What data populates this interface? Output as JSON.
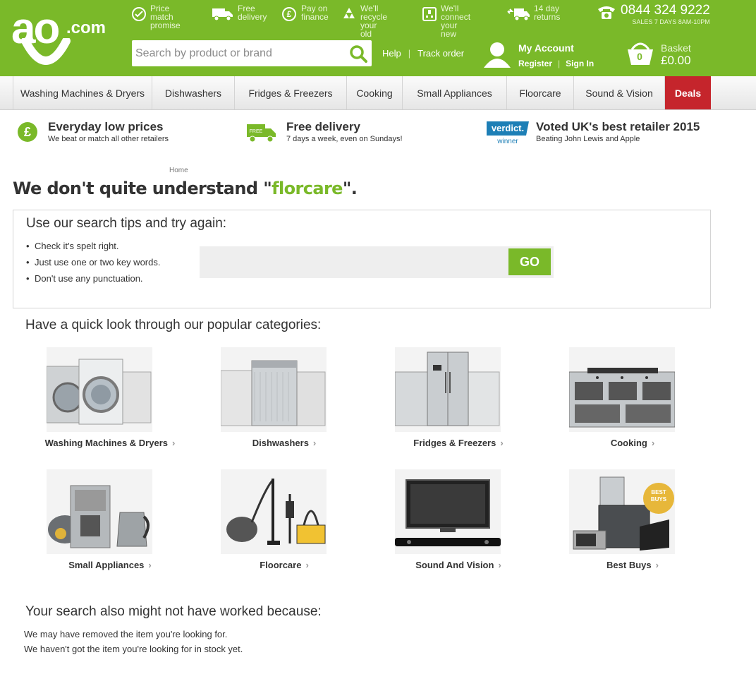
{
  "header": {
    "logo_text": "ao",
    "logo_suffix": ".com",
    "usps": [
      {
        "icon": "price-tag-icon",
        "line1": "Price match",
        "line2": "promise"
      },
      {
        "icon": "delivery-van-icon",
        "line1": "Free",
        "line2": "delivery"
      },
      {
        "icon": "pound-coin-icon",
        "line1": "Pay on",
        "line2": "finance"
      },
      {
        "icon": "recycle-icon",
        "line1": "We'll recycle",
        "line2": "your old"
      },
      {
        "icon": "plug-icon",
        "line1": "We'll connect",
        "line2": "your new"
      },
      {
        "icon": "return-van-icon",
        "line1": "14 day",
        "line2": "returns"
      }
    ],
    "phone_number": "0844 324 9222",
    "phone_hours": "SALES 7 DAYS 8AM-10PM",
    "search_placeholder": "Search by product or brand",
    "help_label": "Help",
    "track_label": "Track order",
    "account_title": "My Account",
    "register_label": "Register",
    "signin_label": "Sign In",
    "basket_count": "0",
    "basket_label": "Basket",
    "basket_total": "£0.00"
  },
  "nav": {
    "items": [
      "Washing Machines & Dryers",
      "Dishwashers",
      "Fridges & Freezers",
      "Cooking",
      "Small Appliances",
      "Floorcare",
      "Sound & Vision"
    ],
    "deals_label": "Deals"
  },
  "promo": [
    {
      "icon": "pound-circle-icon",
      "title": "Everyday low prices",
      "subtitle": "We beat or match all other retailers"
    },
    {
      "icon": "free-delivery-van-icon",
      "title": "Free delivery",
      "subtitle": "7 days a week, even on Sundays!"
    },
    {
      "icon": "verdict-winner-badge",
      "badge_top": "verdict.",
      "badge_bottom": "winner",
      "title": "Voted UK's best retailer 2015",
      "subtitle": "Beating John Lewis and Apple"
    }
  ],
  "content": {
    "breadcrumb": "Home",
    "heading_prefix": "We don't quite understand \"",
    "search_term": "florcare",
    "heading_suffix": "\".",
    "tips_title": "Use our search tips and try again:",
    "tips": [
      "Check it's spelt right.",
      "Just use one or two key words.",
      "Don't use any punctuation."
    ],
    "go_label": "GO",
    "quick_title": "Have a quick look through our popular categories:",
    "categories": [
      {
        "label": "Washing Machines & Dryers",
        "icon": "washing-machine-icon"
      },
      {
        "label": "Dishwashers",
        "icon": "dishwasher-icon"
      },
      {
        "label": "Fridges & Freezers",
        "icon": "fridge-freezer-icon"
      },
      {
        "label": "Cooking",
        "icon": "range-cooker-icon"
      },
      {
        "label": "Small Appliances",
        "icon": "coffee-machine-icon"
      },
      {
        "label": "Floorcare",
        "icon": "vacuum-cleaner-icon"
      },
      {
        "label": "Sound And Vision",
        "icon": "television-icon"
      },
      {
        "label": "Best Buys",
        "icon": "best-buys-icon",
        "badge_line1": "BEST",
        "badge_line2": "BUYS"
      }
    ],
    "why_title": "Your search also might not have worked because:",
    "why_lines": [
      "We may have removed the item you're looking for.",
      "We haven't got the item you're looking for in stock yet."
    ]
  },
  "colors": {
    "brand_green": "#7ab929",
    "deals_red": "#c5252c",
    "text": "#333333"
  }
}
